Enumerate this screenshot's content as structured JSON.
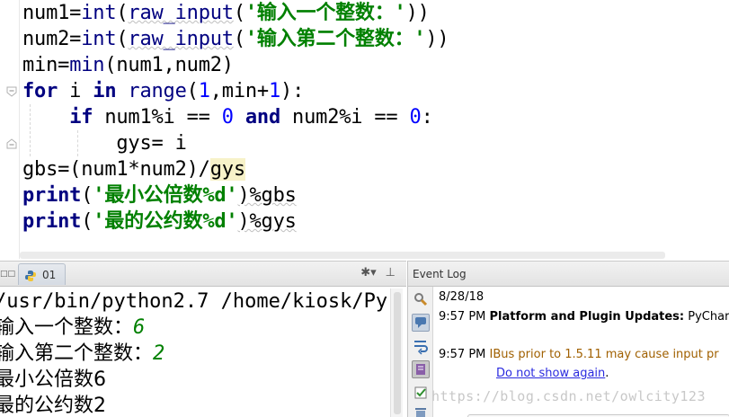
{
  "editor": {
    "lines": [
      {
        "segments": [
          {
            "t": "num1=",
            "c": "plain"
          },
          {
            "t": "int",
            "c": "bi"
          },
          {
            "t": "(",
            "c": "plain"
          },
          {
            "t": "raw_input",
            "c": "bi",
            "ul": true
          },
          {
            "t": "(",
            "c": "plain"
          },
          {
            "t": "'输入一个整数：'",
            "c": "str"
          },
          {
            "t": "))",
            "c": "plain"
          }
        ]
      },
      {
        "segments": [
          {
            "t": "num2=",
            "c": "plain"
          },
          {
            "t": "int",
            "c": "bi"
          },
          {
            "t": "(",
            "c": "plain"
          },
          {
            "t": "raw_input",
            "c": "bi",
            "ul": true
          },
          {
            "t": "(",
            "c": "plain"
          },
          {
            "t": "'输入第二个整数：'",
            "c": "str"
          },
          {
            "t": "))",
            "c": "plain"
          }
        ]
      },
      {
        "segments": [
          {
            "t": "min=",
            "c": "plain"
          },
          {
            "t": "min",
            "c": "bi"
          },
          {
            "t": "(num1,num2)",
            "c": "plain"
          }
        ]
      },
      {
        "segments": [
          {
            "t": "for",
            "c": "kw"
          },
          {
            "t": " i ",
            "c": "plain"
          },
          {
            "t": "in",
            "c": "kw"
          },
          {
            "t": " ",
            "c": "plain"
          },
          {
            "t": "range",
            "c": "bi"
          },
          {
            "t": "(",
            "c": "plain"
          },
          {
            "t": "1",
            "c": "num"
          },
          {
            "t": ",min+",
            "c": "plain"
          },
          {
            "t": "1",
            "c": "num"
          },
          {
            "t": "):",
            "c": "plain"
          }
        ]
      },
      {
        "segments": [
          {
            "t": "    ",
            "c": "plain"
          },
          {
            "t": "if",
            "c": "kw"
          },
          {
            "t": " num1%i == ",
            "c": "plain"
          },
          {
            "t": "0",
            "c": "num"
          },
          {
            "t": " ",
            "c": "plain"
          },
          {
            "t": "and",
            "c": "kw"
          },
          {
            "t": " num2%i == ",
            "c": "plain"
          },
          {
            "t": "0",
            "c": "num"
          },
          {
            "t": ":",
            "c": "plain"
          }
        ]
      },
      {
        "segments": [
          {
            "t": "        gys= i",
            "c": "plain"
          }
        ]
      },
      {
        "segments": [
          {
            "t": "gbs=(num1*num2)/",
            "c": "plain"
          },
          {
            "t": "gys",
            "c": "hl"
          }
        ]
      },
      {
        "segments": [
          {
            "t": "print",
            "c": "kw"
          },
          {
            "t": "(",
            "c": "plain"
          },
          {
            "t": "'最小公倍数%d'",
            "c": "str"
          },
          {
            "t": ")%gbs",
            "c": "plain",
            "ul": true
          }
        ]
      },
      {
        "segments": [
          {
            "t": "print",
            "c": "kw"
          },
          {
            "t": "(",
            "c": "plain"
          },
          {
            "t": "'最的公约数%d'",
            "c": "str"
          },
          {
            "t": ")%gys",
            "c": "plain",
            "ul": true
          }
        ]
      }
    ]
  },
  "run": {
    "left_icon": "□□",
    "tab_label": "01",
    "tool_gear": "✱▾",
    "tool_pin": "⊥",
    "console": {
      "command": "/usr/bin/python2.7 /home/kiosk/Py",
      "prompt1": "输入一个整数：",
      "input1": "6",
      "prompt2": "输入第二个整数：",
      "input2": "2",
      "out1": "最小公倍数6",
      "out2": "最的公约数2"
    }
  },
  "event_log": {
    "title": "Event Log",
    "date": "8/28/18",
    "entry1_time": "9:57 PM",
    "entry1_text": "Platform and Plugin Updates:",
    "entry1_rest": " PyCharm",
    "entry2_time": "9:57 PM",
    "entry2_text": "IBus prior to 1.5.11 may cause input pr",
    "entry2_link": "Do not show again",
    "entry2_after": "."
  },
  "watermark": "https://blog.csdn.net/owlcity123",
  "colors": {
    "keyword": "#000080",
    "string": "#008000",
    "number": "#0000ff",
    "warning": "#a06000",
    "link": "#2a2adf"
  }
}
